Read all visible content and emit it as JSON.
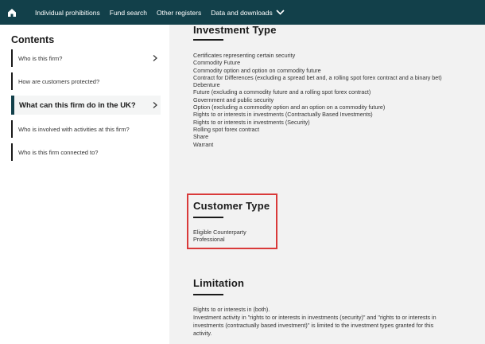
{
  "nav": {
    "items": [
      "Individual prohibitions",
      "Fund search",
      "Other registers",
      "Data and downloads"
    ]
  },
  "sidebar": {
    "title": "Contents",
    "items": [
      {
        "label": "Who is this firm?"
      },
      {
        "label": "How are customers protected?"
      },
      {
        "label": "What can this firm do in the UK?"
      },
      {
        "label": "Who is involved with activities at this firm?"
      },
      {
        "label": "Who is this firm connected to?"
      }
    ]
  },
  "investment": {
    "title": "Investment Type",
    "items": [
      "Certificates representing certain security",
      "Commodity Future",
      "Commodity option and option on commodity future",
      "Contract for Differences (excluding a spread bet and, a rolling spot forex contract and a binary bet)",
      "Debenture",
      "Future (excluding a commodity future and a rolling spot forex contract)",
      "Government and public security",
      "Option (excluding a commodity option and an option on a commodity future)",
      "Rights to or interests in investments (Contractually Based Investments)",
      "Rights to or interests in investments (Security)",
      "Rolling spot forex contract",
      "Share",
      "Warrant"
    ]
  },
  "customer": {
    "title": "Customer Type",
    "items": [
      "Eligible Counterparty",
      "Professional"
    ]
  },
  "limitation": {
    "title": "Limitation",
    "line1": "Rights to or interests in (both).",
    "line2": "Investment activity in \"rights to or interests in investments (security)\" and \"rights to or interests in",
    "line3": "investments (contractually based investment)\" is limited to the investment types granted for this",
    "line4": "activity."
  },
  "colors": {
    "nav_bg": "#12404a",
    "highlight_border": "#d93a3a",
    "main_bg": "#f2f2f2"
  }
}
